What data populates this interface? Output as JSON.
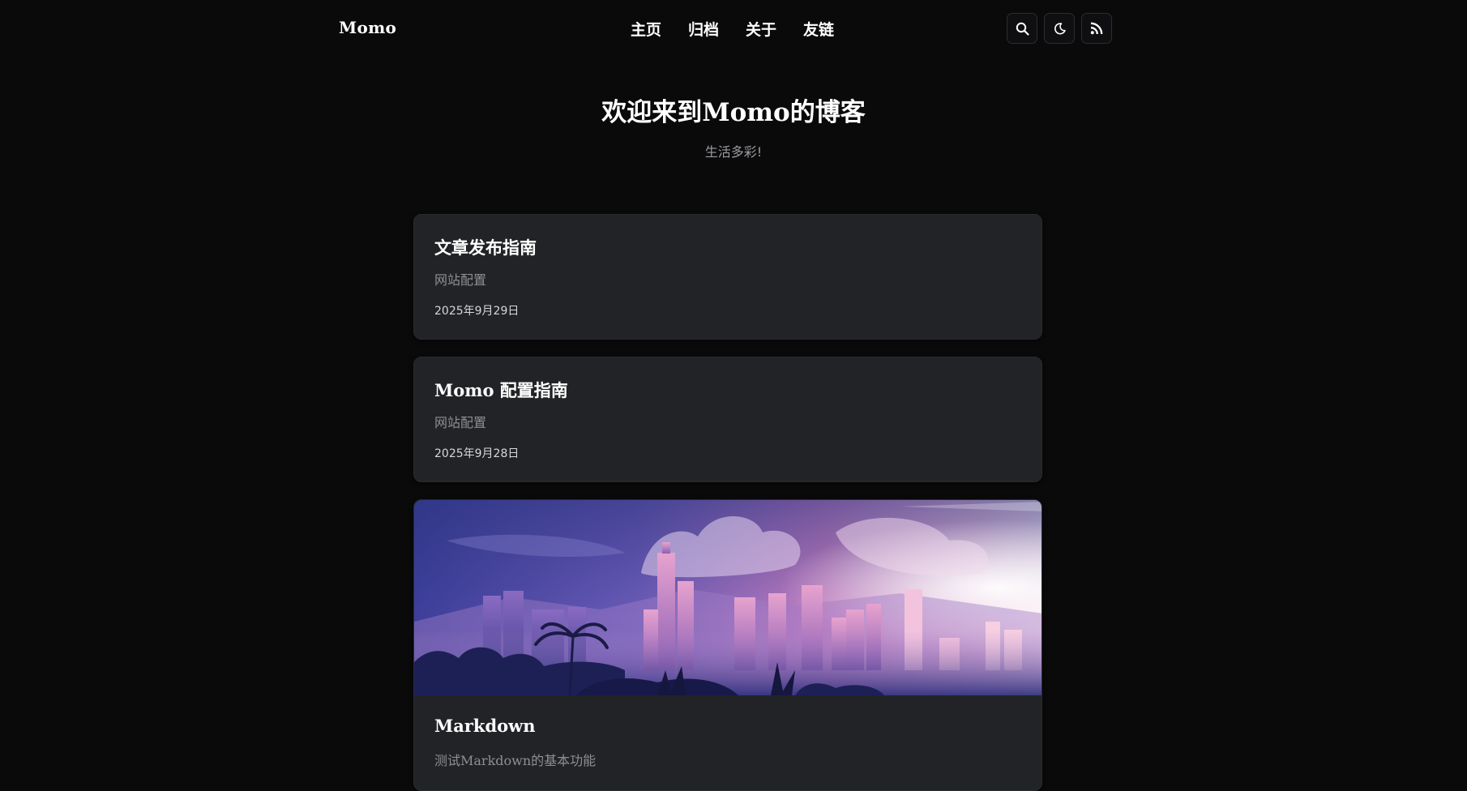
{
  "header": {
    "brand": "Momo",
    "nav": [
      {
        "label": "主页"
      },
      {
        "label": "归档"
      },
      {
        "label": "关于"
      },
      {
        "label": "友链"
      }
    ],
    "tools": [
      {
        "icon": "search-icon"
      },
      {
        "icon": "moon-icon"
      },
      {
        "icon": "rss-icon"
      }
    ]
  },
  "hero": {
    "title": "欢迎来到Momo的博客",
    "subtitle": "生活多彩!"
  },
  "posts": [
    {
      "title": "文章发布指南",
      "category": "网站配置",
      "date": "2025年9月29日"
    },
    {
      "title": "Momo 配置指南",
      "category": "网站配置",
      "date": "2025年9月28日"
    },
    {
      "title": "Markdown",
      "category": "测试Markdown的基本功能",
      "cover": "city-skyline-illustration"
    }
  ],
  "colors": {
    "background": "#0a0a0b",
    "card": "#222326",
    "text": "#ffffff",
    "muted": "#8e8f94"
  }
}
